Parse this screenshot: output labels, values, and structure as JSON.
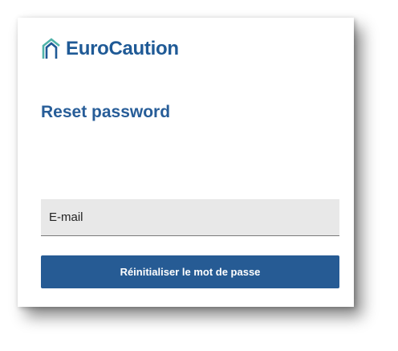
{
  "brand": {
    "name": "EuroCaution",
    "icon": "house-outline-icon",
    "color": "#1f5a96",
    "icon_accent": "#4fb3a9"
  },
  "form": {
    "title": "Reset password",
    "email_placeholder": "E-mail",
    "email_value": "",
    "submit_label": "Réinitialiser le mot de passe"
  },
  "colors": {
    "primary": "#265b94",
    "field_bg": "#e8e8e8"
  }
}
